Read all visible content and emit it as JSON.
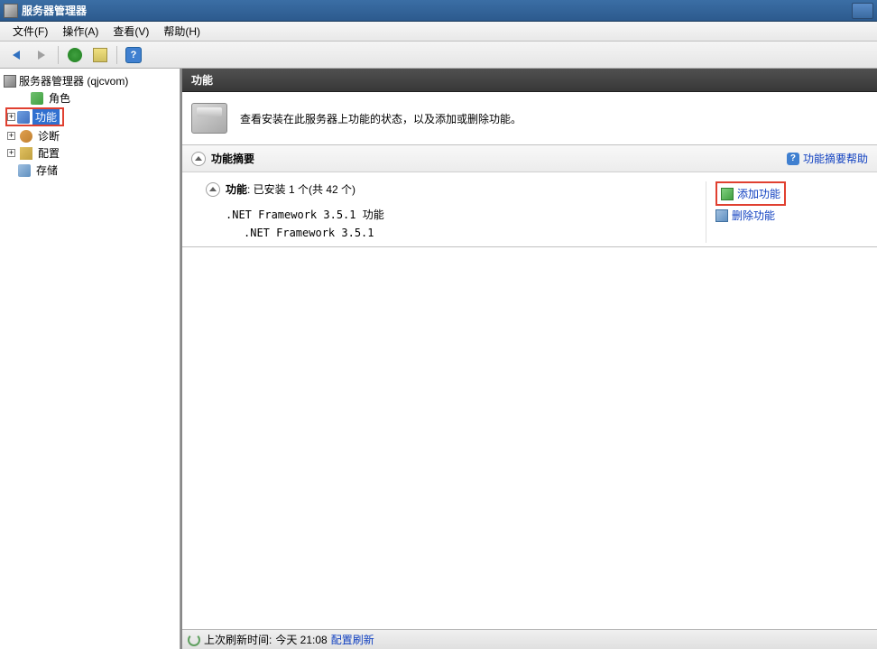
{
  "titlebar": {
    "title": "服务器管理器"
  },
  "menubar": {
    "file": "文件(F)",
    "action": "操作(A)",
    "view": "查看(V)",
    "help": "帮助(H)"
  },
  "tree": {
    "root": "服务器管理器 (qjcvom)",
    "roles": "角色",
    "features": "功能",
    "diagnostics": "诊断",
    "configuration": "配置",
    "storage": "存储"
  },
  "content": {
    "header": "功能",
    "description": "查看安装在此服务器上功能的状态，以及添加或删除功能。",
    "summary": {
      "title": "功能摘要",
      "help_link": "功能摘要帮助"
    },
    "features_section": {
      "label": "功能",
      "installed_text": ": 已安装 1 个(共 42 个)",
      "items": [
        ".NET Framework 3.5.1 功能",
        ".NET Framework 3.5.1"
      ],
      "add_link": "添加功能",
      "remove_link": "删除功能"
    }
  },
  "status": {
    "last_refresh_label": "上次刷新时间: ",
    "last_refresh_value": "今天 21:08",
    "config_refresh": "配置刷新"
  }
}
